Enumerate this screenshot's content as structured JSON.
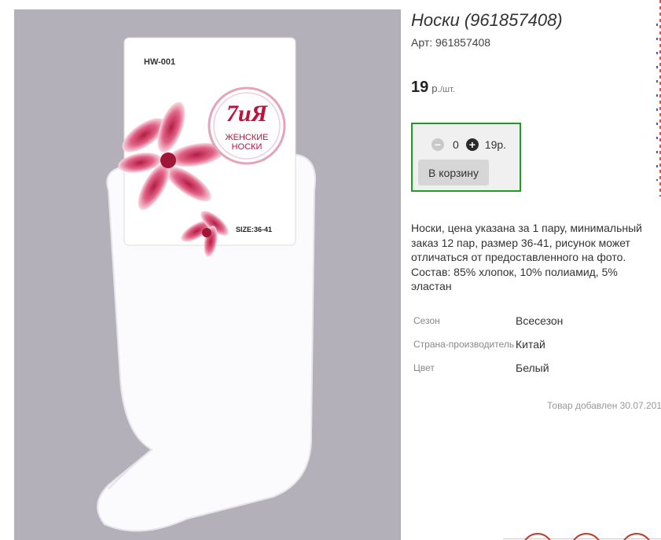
{
  "product": {
    "title": "Носки (961857408)",
    "sku": "Арт: 961857408",
    "price": "19",
    "price_unit": "р.",
    "price_per": "/шт.",
    "description": "Носки, цена указана за 1 пару, минимальный заказ 12 пар, размер 36-41, рисунок может отличаться от предоставленного на фото. Состав: 85% хлопок, 10% полиамид, 5% эластан",
    "added": "Товар добавлен 30.07.201"
  },
  "photo": {
    "tag_model": "HW-001",
    "brand_logo": "7иЯ",
    "brand_line1": "ЖЕНСКИЕ",
    "brand_line2": "НОСКИ",
    "tag_size": "SIZE:36-41"
  },
  "cart": {
    "minus_icon": "minus-circle-icon",
    "plus_icon": "plus-circle-icon",
    "quantity": "0",
    "sum": "19р.",
    "button_label": "В корзину",
    "accent_color": "#1f9d1f"
  },
  "properties": [
    {
      "label": "Сезон",
      "value": "Всесезон"
    },
    {
      "label": "Страна-производитель",
      "value": "Китай"
    },
    {
      "label": "Цвет",
      "value": "Белый"
    }
  ]
}
